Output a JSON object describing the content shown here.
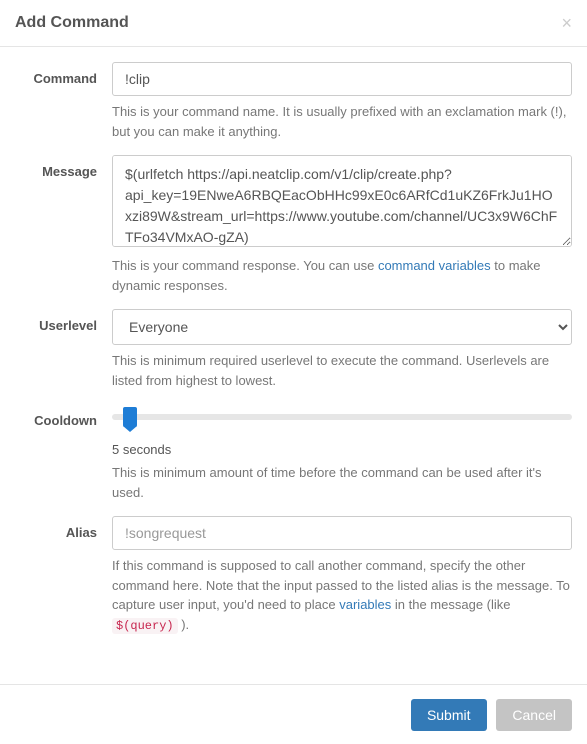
{
  "modal": {
    "title": "Add Command"
  },
  "fields": {
    "command": {
      "label": "Command",
      "value": "!clip",
      "help": "This is your command name. It is usually prefixed with an exclamation mark (!), but you can make it anything."
    },
    "message": {
      "label": "Message",
      "value": "$(urlfetch https://api.neatclip.com/v1/clip/create.php?api_key=19ENweA6RBQEacObHHc99xE0c6ARfCd1uKZ6FrkJu1HOxzi89W&stream_url=https://www.youtube.com/channel/UC3x9W6ChFTFo34VMxAO-gZA)",
      "help_before": "This is your command response. You can use ",
      "help_link": "command variables",
      "help_after": " to make dynamic responses."
    },
    "userlevel": {
      "label": "Userlevel",
      "value": "Everyone",
      "help": "This is minimum required userlevel to execute the command. Userlevels are listed from highest to lowest."
    },
    "cooldown": {
      "label": "Cooldown",
      "value_text": "5 seconds",
      "help": "This is minimum amount of time before the command can be used after it's used."
    },
    "alias": {
      "label": "Alias",
      "placeholder": "!songrequest",
      "help_p1": "If this command is supposed to call another command, specify the other command here. Note that the input passed to the listed alias is the message. To capture user input, you'd need to place ",
      "help_link": "variables",
      "help_p2": " in the message (like ",
      "help_code": "$(query)",
      "help_p3": " )."
    }
  },
  "buttons": {
    "submit": "Submit",
    "cancel": "Cancel"
  }
}
